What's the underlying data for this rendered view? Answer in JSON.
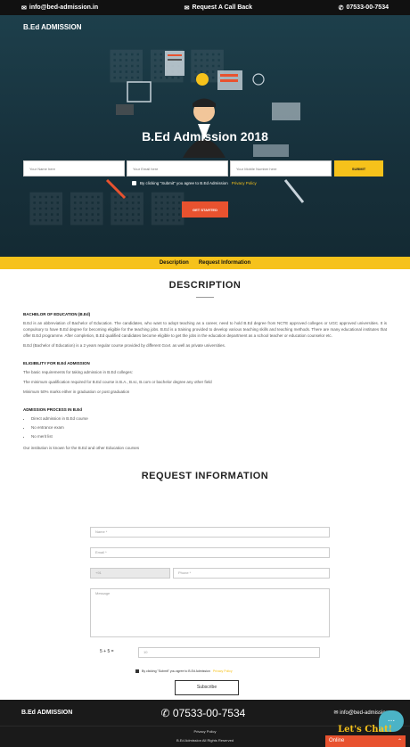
{
  "topbar": {
    "email": "info@bed-admission.in",
    "callback": "Request A Call Back",
    "phone": "07533-00-7534"
  },
  "hero": {
    "brand": "B.Ed ADMISSION",
    "title": "B.Ed Admission 2018",
    "name_ph": "Your Name here",
    "email_ph": "Your Email here",
    "mobile_ph": "Your Mobile Number here",
    "submit": "SUBMIT",
    "agree_text": "By clicking \"Submit\" you agree to B.Ed Admission",
    "privacy": "Privacy Policy",
    "cta": "GET STARTED"
  },
  "tabs": [
    "Description",
    "Request Information"
  ],
  "description": {
    "heading": "DESCRIPTION",
    "s1_title": "BACHELOR OF EDUCATION (B.Ed)",
    "s1_p1": "B.Ed is an abbreviation of Bachelor of Education. The candidates, who want to adopt teaching as a career, need to hold B.Ed degree from NCTE approved colleges or UGC approved universities. It is compulsory to have B.Ed degree for becoming eligible for the teaching jobs. B.Ed is a training provided to develop various teaching skills and teaching methods. There are many educational institutes that offer B.Ed programme. After completion, B.Ed qualified candidates become eligible to get the jobs in the education department as a school teacher or education counselor etc.",
    "s1_p2": "B.Ed (Bachelor of Education) is a 2 years regular course provided by different Govt. as well as private universities.",
    "s2_title": "ELIGIBILITY FOR B.Ed ADMISSION",
    "s2_p1": "The basic requirements for taking admission in B.Ed colleges:",
    "s2_p2": "The minimum qualification required for B.Ed course is B.A., B.sc, B.com or bachelor degree any other field",
    "s2_p3": "Minimum 50% marks either in graduation or post graduation",
    "s3_title": "ADMISSION PROCESS IN B.Ed",
    "s3_items": [
      "Direct admission in B.Ed course",
      "No entrance exam",
      "No merit list"
    ],
    "s3_p": "Our institution is known for the B.Ed and other Education courses"
  },
  "request": {
    "heading": "REQUEST INFORMATION",
    "name_ph": "Name *",
    "email_ph": "Email *",
    "code": "+91",
    "phone_ph": "Phone *",
    "message_ph": "Message",
    "captcha": "5 + 5 =",
    "captcha_ph": "10",
    "agree_text": "By clicking \"Submit\" you agree to B.Ed Admission",
    "privacy": "Privacy Policy",
    "subscribe": "Subscribe"
  },
  "footer": {
    "brand": "B.Ed ADMISSION",
    "phone": "07533-00-7534",
    "email": "info@bed-admission",
    "privacy": "Privacy Policy",
    "copyright": "B.Ed Admission All Rights Reserved"
  },
  "chat": {
    "bubble": "...",
    "title": "Let's Chat!",
    "status": "Online"
  },
  "colors": {
    "accent": "#f6c21b",
    "cta": "#e8522f",
    "hero": "#1d3f4b"
  }
}
